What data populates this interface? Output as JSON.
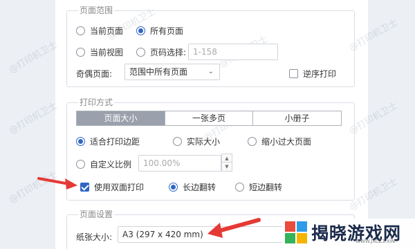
{
  "page_range": {
    "legend": "页面范围",
    "current_page": "当前页面",
    "all_pages": "所有页面",
    "current_view": "当前视图",
    "page_select": "页码选择:",
    "page_select_placeholder": "1-158",
    "odd_even_label": "奇偶页面:",
    "odd_even_value": "范围中所有页面",
    "reverse": "逆序打印"
  },
  "print_mode": {
    "legend": "打印方式",
    "tabs": [
      "页面大小",
      "一张多页",
      "小册子"
    ],
    "fit_margins": "适合打印边距",
    "actual_size": "实际大小",
    "shrink_large": "缩小过大页面",
    "custom_scale": "自定义比例",
    "custom_scale_value": "100.00%",
    "duplex": "使用双面打印",
    "long_edge": "长边翻转",
    "short_edge": "短边翻转"
  },
  "page_setup": {
    "legend": "页面设置",
    "paper_size_label": "纸张大小:",
    "paper_size_value": "A3 (297 x 420 mm)"
  },
  "watermark": "@打印机卫士",
  "logo": {
    "text": "揭晓游戏网",
    "url": "WWW.JXCZ3.XIN"
  },
  "colors": {
    "accent": "#2f66c7",
    "arrow": "#e53935",
    "tab_active": "#9aa1ac"
  }
}
